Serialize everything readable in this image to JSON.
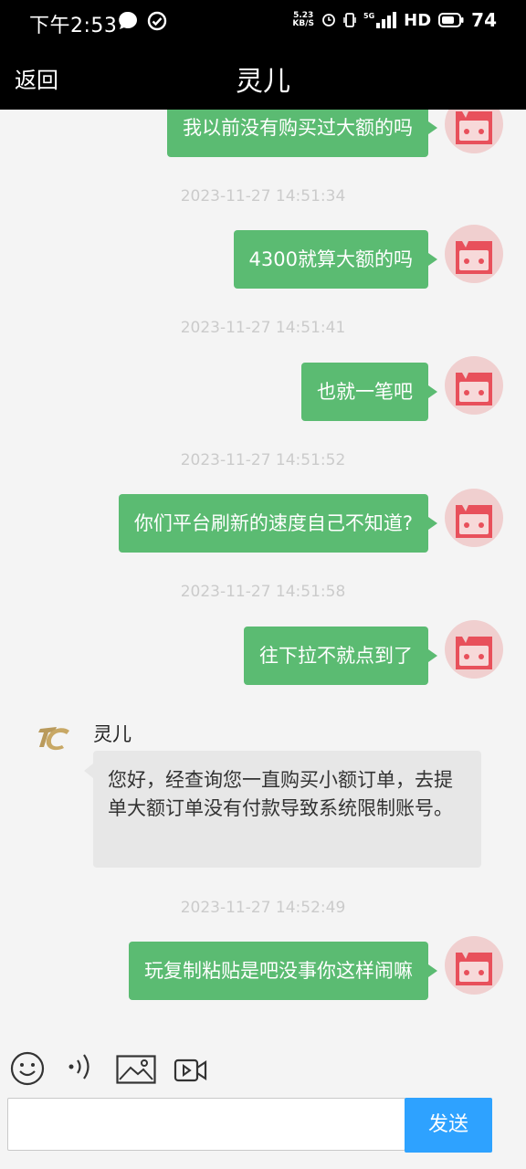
{
  "status": {
    "time": "下午2:53",
    "speed_value": "5.23",
    "speed_unit": "KB/S",
    "network": "5G",
    "hd": "HD",
    "battery": "74"
  },
  "header": {
    "back_label": "返回",
    "title": "灵儿"
  },
  "messages": [
    {
      "type": "out",
      "text": "我以前没有购买过大额的吗"
    },
    {
      "type": "timestamp",
      "text": "2023-11-27 14:51:34"
    },
    {
      "type": "out",
      "text": "4300就算大额的吗"
    },
    {
      "type": "timestamp",
      "text": "2023-11-27 14:51:41"
    },
    {
      "type": "out",
      "text": "也就一笔吧"
    },
    {
      "type": "timestamp",
      "text": "2023-11-27 14:51:52"
    },
    {
      "type": "out",
      "text": "你们平台刷新的速度自己不知道?"
    },
    {
      "type": "timestamp",
      "text": "2023-11-27 14:51:58"
    },
    {
      "type": "out",
      "text": "往下拉不就点到了"
    },
    {
      "type": "in",
      "name": "灵儿",
      "text": "您好，经查询您一直购买小额订单，去提单大额订单没有付款导致系统限制账号。"
    },
    {
      "type": "timestamp",
      "text": "2023-11-27 14:52:49"
    },
    {
      "type": "out",
      "text": "玩复制粘贴是吧没事你这样闹嘛"
    }
  ],
  "composer": {
    "placeholder": "",
    "send_label": "发送"
  },
  "colors": {
    "outgoing_bubble": "#5bbb72",
    "incoming_bubble": "#e7e7e7",
    "send_button": "#2ea2ff",
    "header": "#000000",
    "avatar": "#e8505b"
  },
  "icons": [
    "emoji-icon",
    "voice-icon",
    "image-icon",
    "video-icon"
  ]
}
